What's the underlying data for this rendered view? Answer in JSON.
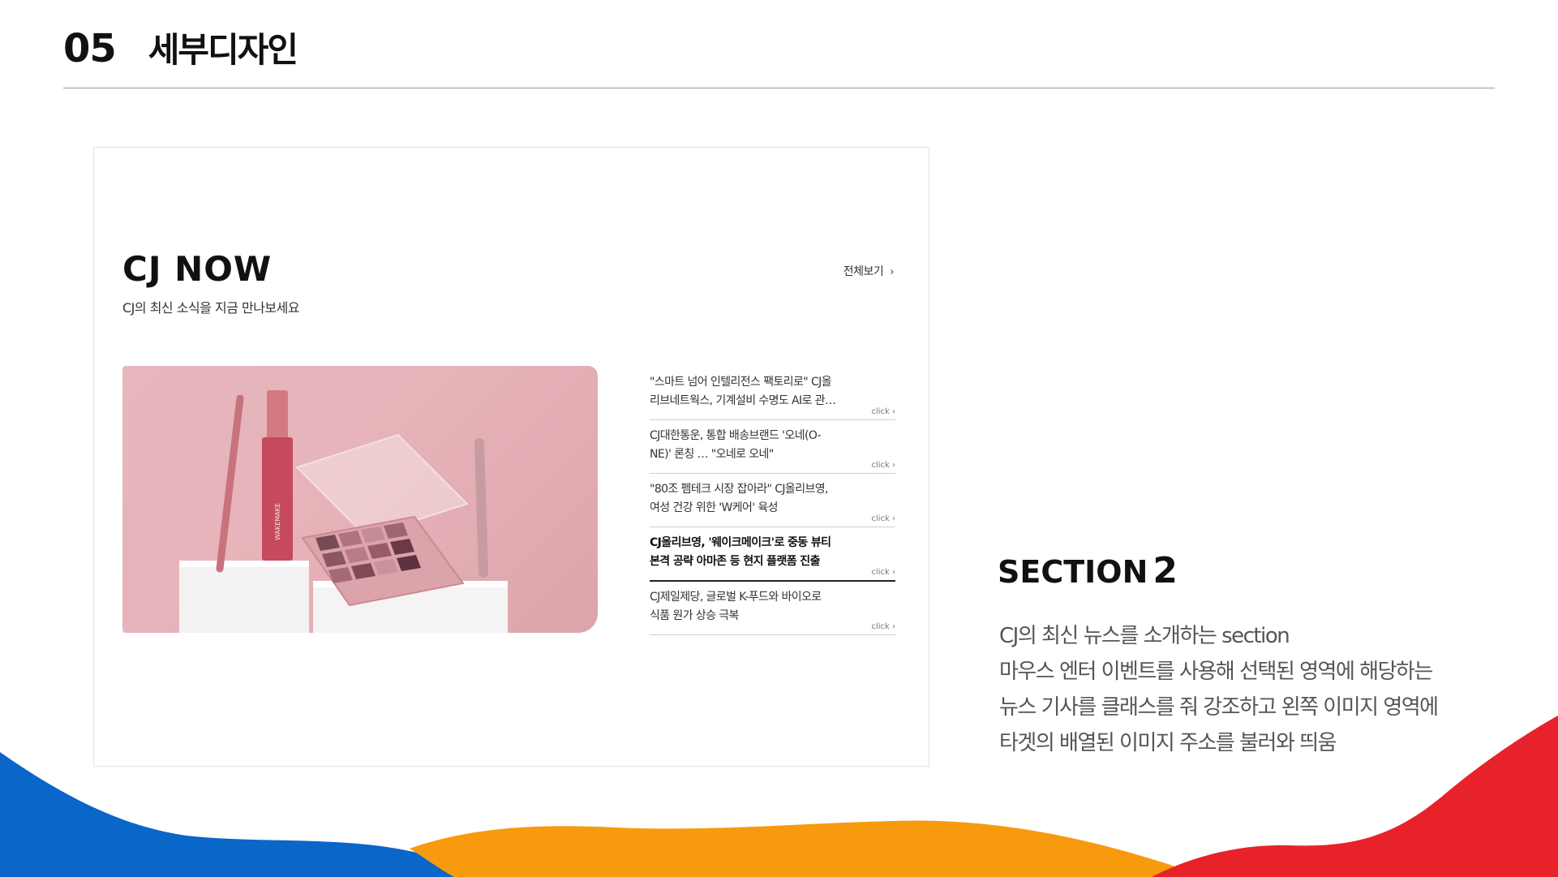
{
  "header": {
    "number": "05",
    "title": "세부디자인"
  },
  "mockup": {
    "brand_title": "CJ NOW",
    "subtitle": "CJ의 최신 소식을 지금 만나보세요",
    "view_all": "전체보기",
    "view_all_icon": "chevron-right-icon",
    "news": [
      {
        "line1": "\"스마트 넘어 인텔리전스 팩토리로\" CJ올",
        "line2": "리브네트웍스, 기계설비 수명도 AI로 관…",
        "click": "click",
        "active": false
      },
      {
        "line1": "CJ대한통운, 통합 배송브랜드 '오네(O-",
        "line2": "NE)' 론칭 … \"오네로 오네\"",
        "click": "click",
        "active": false
      },
      {
        "line1": "\"80조 펨테크 시장 잡아라\" CJ올리브영,",
        "line2": "여성 건강 위한 'W케어' 육성",
        "click": "click",
        "active": false
      },
      {
        "line1": "CJ올리브영, '웨이크메이크'로 중동 뷰티",
        "line2": "본격 공략 아마존 등 현지 플랫폼 진출",
        "click": "click",
        "active": true
      },
      {
        "line1": "CJ제일제당, 글로벌 K-푸드와 바이오로",
        "line2": "식품 원가 상승 극복",
        "click": "click",
        "active": false
      }
    ],
    "image_caption": "WAKEMAKE"
  },
  "section": {
    "title": "SECTION",
    "number": "2",
    "desc": [
      "CJ의 최신 뉴스를 소개하는 section",
      "마우스 엔터 이벤트를 사용해 선택된 영역에 해당하는",
      "뉴스 기사를 클래스를 줘 강조하고 왼쪽 이미지 영역에",
      "타겟의 배열된 이미지 주소를 불러와 띄움"
    ]
  },
  "colors": {
    "blue": "#0a66c8",
    "orange": "#f79a0e",
    "red": "#e8222b",
    "pink_bg": "#e6b3b9"
  }
}
